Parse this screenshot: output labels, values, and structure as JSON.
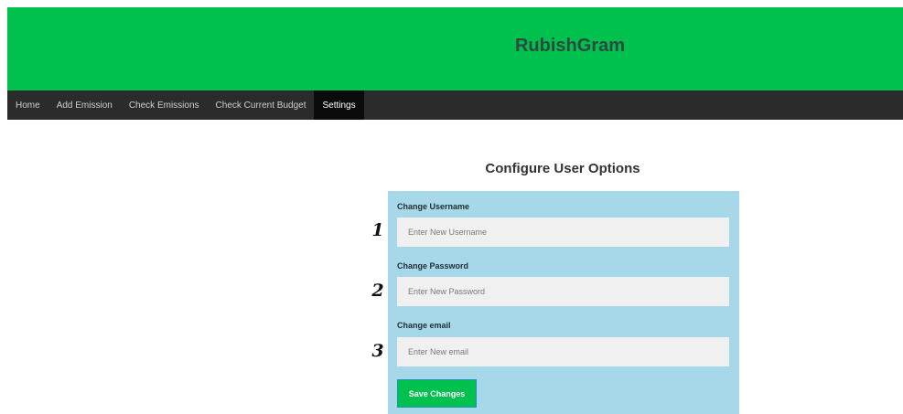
{
  "header": {
    "title": "RubishGram"
  },
  "nav": {
    "items": [
      {
        "label": "Home"
      },
      {
        "label": "Add Emission"
      },
      {
        "label": "Check Emissions"
      },
      {
        "label": "Check Current Budget"
      },
      {
        "label": "Settings"
      }
    ],
    "active": "Settings"
  },
  "main": {
    "title": "Configure User Options",
    "form": {
      "username": {
        "label": "Change Username",
        "placeholder": "Enter New Username",
        "value": ""
      },
      "password": {
        "label": "Change Password",
        "placeholder": "Enter New Password",
        "value": ""
      },
      "email": {
        "label": "Change email",
        "placeholder": "Enter New email",
        "value": ""
      },
      "save_label": "Save Changes"
    },
    "field_numbers": [
      "1",
      "2",
      "3"
    ]
  },
  "colors": {
    "header_bg": "#00c04e",
    "nav_bg": "#2b2b2b",
    "nav_active_bg": "#0b0b0b",
    "panel_bg": "#a7d8ea",
    "input_bg": "#f0f0f0",
    "button_bg": "#00c04e"
  }
}
